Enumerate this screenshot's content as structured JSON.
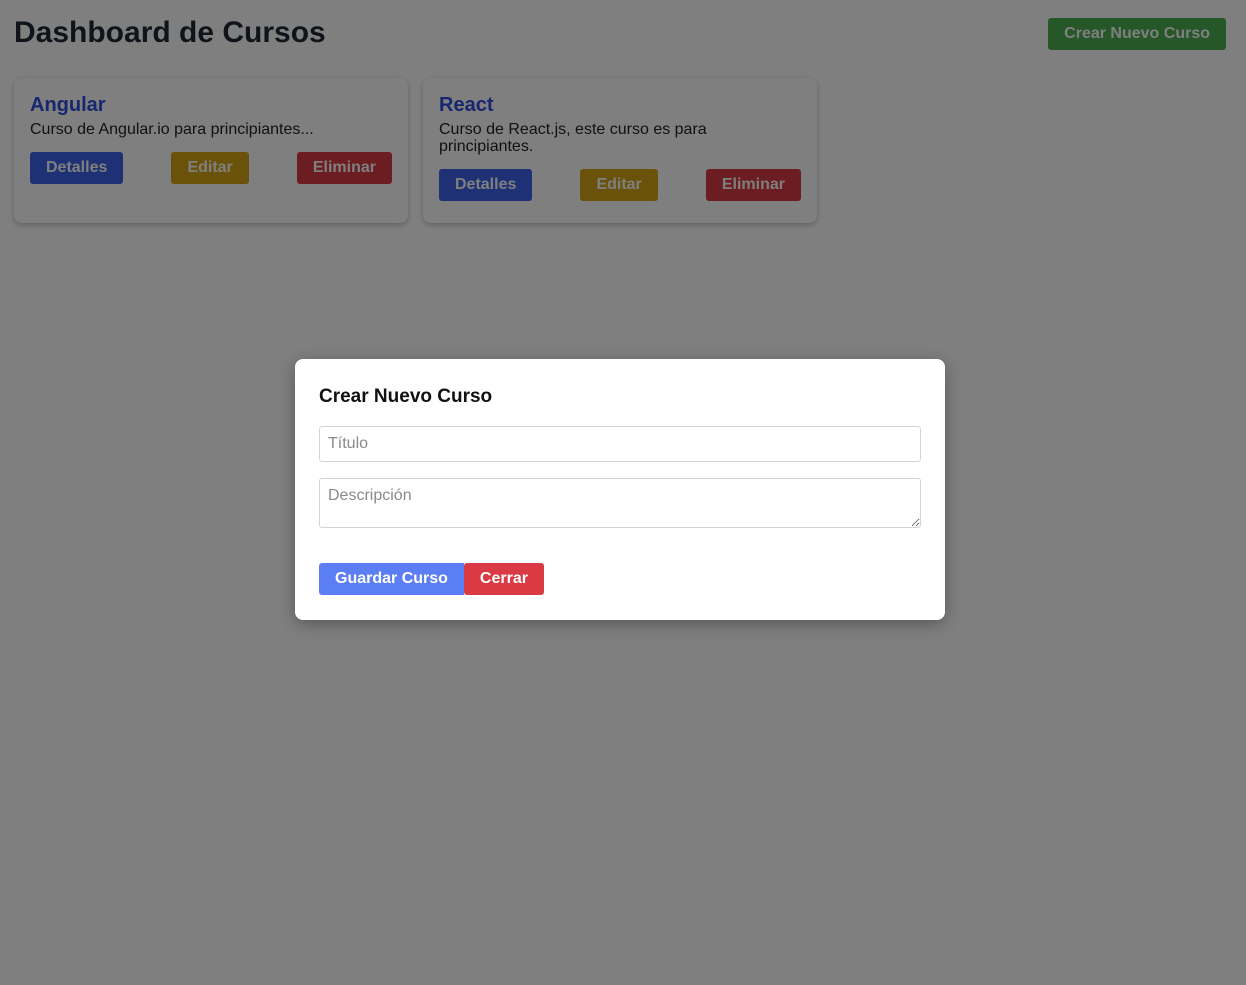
{
  "header": {
    "title": "Dashboard de Cursos",
    "create_button": "Crear Nuevo Curso"
  },
  "courses": [
    {
      "title": "Angular",
      "description": "Curso de Angular.io para principiantes...",
      "details_label": "Detalles",
      "edit_label": "Editar",
      "delete_label": "Eliminar"
    },
    {
      "title": "React",
      "description": "Curso de React.js, este curso es para principiantes.",
      "details_label": "Detalles",
      "edit_label": "Editar",
      "delete_label": "Eliminar"
    }
  ],
  "modal": {
    "title": "Crear Nuevo Curso",
    "title_placeholder": "Título",
    "title_value": "",
    "description_placeholder": "Descripción",
    "description_value": "",
    "save_label": "Guardar Curso",
    "close_label": "Cerrar"
  },
  "colors": {
    "create": "#4caf50",
    "details": "#3b63e8",
    "edit": "#d4a514",
    "delete": "#d93a43",
    "save": "#5b7ef5",
    "course_title": "#2c4fe0"
  }
}
